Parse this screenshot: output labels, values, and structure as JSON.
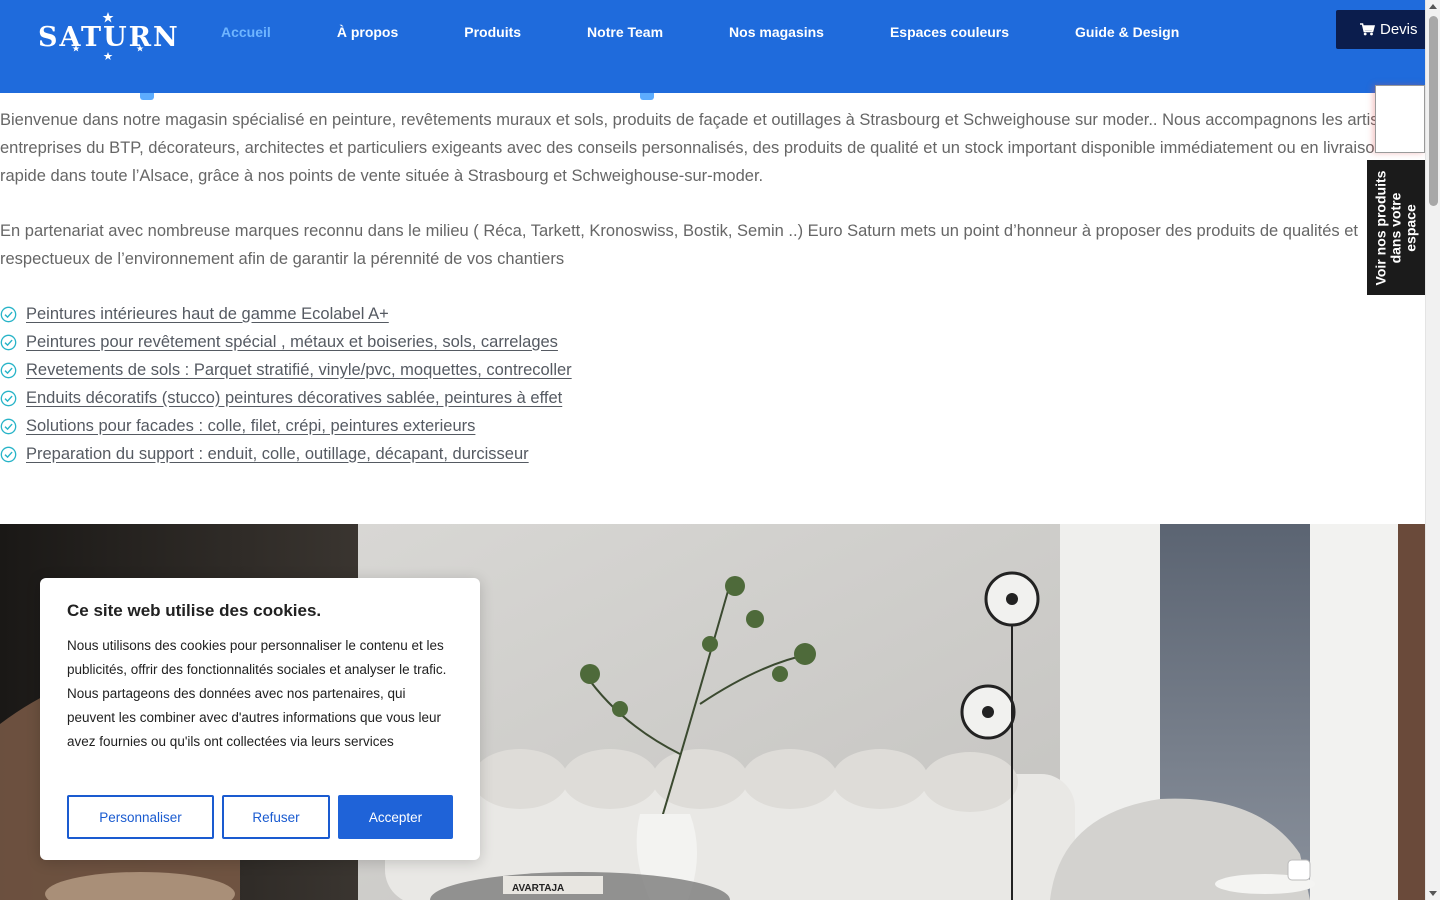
{
  "header": {
    "logo_text": "SATURN",
    "nav": [
      {
        "label": "Accueil",
        "active": true
      },
      {
        "label": "À propos"
      },
      {
        "label": "Produits"
      },
      {
        "label": "Notre Team"
      },
      {
        "label": "Nos magasins"
      },
      {
        "label": "Espaces couleurs"
      },
      {
        "label": "Guide & Design"
      }
    ],
    "devis_label": "Devis"
  },
  "intro": {
    "paragraph_1": "Bienvenue dans notre magasin spécialisé en peinture, revêtements muraux et sols, produits de façade et outillages à Strasbourg et Schweighouse sur moder.. Nous accompagnons les artisans, entreprises du BTP, décorateurs, architectes et particuliers exigeants avec des conseils personnalisés, des produits de qualité et un stock important disponible immédiatement ou en livraison rapide dans toute l’Alsace, grâce à nos points de vente située à Strasbourg et Schweighouse-sur-moder.",
    "paragraph_2": "En partenariat avec nombreuse marques  reconnu dans le milieu ( Réca, Tarkett, Kronoswiss, Bostik, Semin ..) Euro Saturn mets un point d’honneur à proposer des produits de qualités et respectueux de l’environnement afin de garantir la pérennité de vos chantiers"
  },
  "features": [
    "Peintures intérieures haut de gamme Ecolabel A+",
    "Peintures pour revêtement spécial , métaux et boiseries, sols, carrelages",
    "Revetements de sols : Parquet stratifié, vinyle/pvc, moquettes, contrecoller",
    "Enduits décoratifs (stucco) peintures décoratives sablée, peintures à effet",
    "Solutions pour facades : colle, filet, crépi, peintures exterieurs",
    "Preparation du support : enduit, colle, outillage, décapant, durcisseur"
  ],
  "side_tab_label": "Voir nos produits dans votre espace",
  "hero": {
    "book_label": "AVARTAJA"
  },
  "cookie": {
    "title": "Ce site web utilise des cookies.",
    "text": "Nous utilisons des cookies pour personnaliser le contenu et les publicités, offrir des fonctionnalités sociales et analyser le trafic. Nous partageons des données avec nos partenaires, qui peuvent les combiner avec d'autres informations que vous leur avez fournies ou qu'ils ont collectées via leurs services",
    "customize_label": "Personnaliser",
    "refuse_label": "Refuser",
    "accept_label": "Accepter"
  },
  "colors": {
    "header_blue": "#1f6bdc",
    "active_nav": "#6fb5ff",
    "devis_bg": "#0b1d4d",
    "accept_bg": "#1f63d8",
    "check_color": "#28b4c8"
  }
}
